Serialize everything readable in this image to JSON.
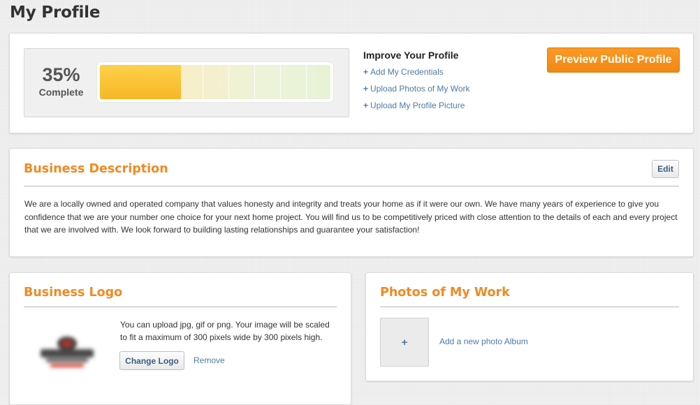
{
  "page": {
    "title": "My Profile"
  },
  "progress": {
    "percent_label": "35%",
    "complete_label": "Complete",
    "fraction": 0.35
  },
  "improve": {
    "title": "Improve Your Profile",
    "links": [
      {
        "icon": "plus",
        "label": "Add My Credentials"
      },
      {
        "icon": "plus",
        "label": "Upload Photos of My Work"
      },
      {
        "icon": "plus",
        "label": "Upload My Profile Picture"
      }
    ]
  },
  "preview_button": "Preview Public Profile",
  "business_description": {
    "title": "Business Description",
    "edit_label": "Edit",
    "text": "We are a locally owned and operated company that values honesty and integrity and treats your home as if it were our own. We have many years of experience to give you confidence that we are your number one choice for your next home project. You will find us to be competitively priced with close attention to the details of each and every project that we are involved with. We look forward to building lasting relationships and guarantee your satisfaction!"
  },
  "business_logo": {
    "title": "Business Logo",
    "help_text": "You can upload jpg, gif or png. Your image will be scaled to fit a maximum of 300 pixels wide by 300 pixels high.",
    "change_label": "Change Logo",
    "remove_label": "Remove"
  },
  "photos": {
    "title": "Photos of My Work",
    "tile_icon": "plus",
    "add_album_label": "Add a new photo Album"
  },
  "colors": {
    "accent_orange": "#f08a24",
    "button_orange": "#f7921c",
    "link_blue": "#4e7aa8",
    "progress_fill": "#f9c233"
  }
}
